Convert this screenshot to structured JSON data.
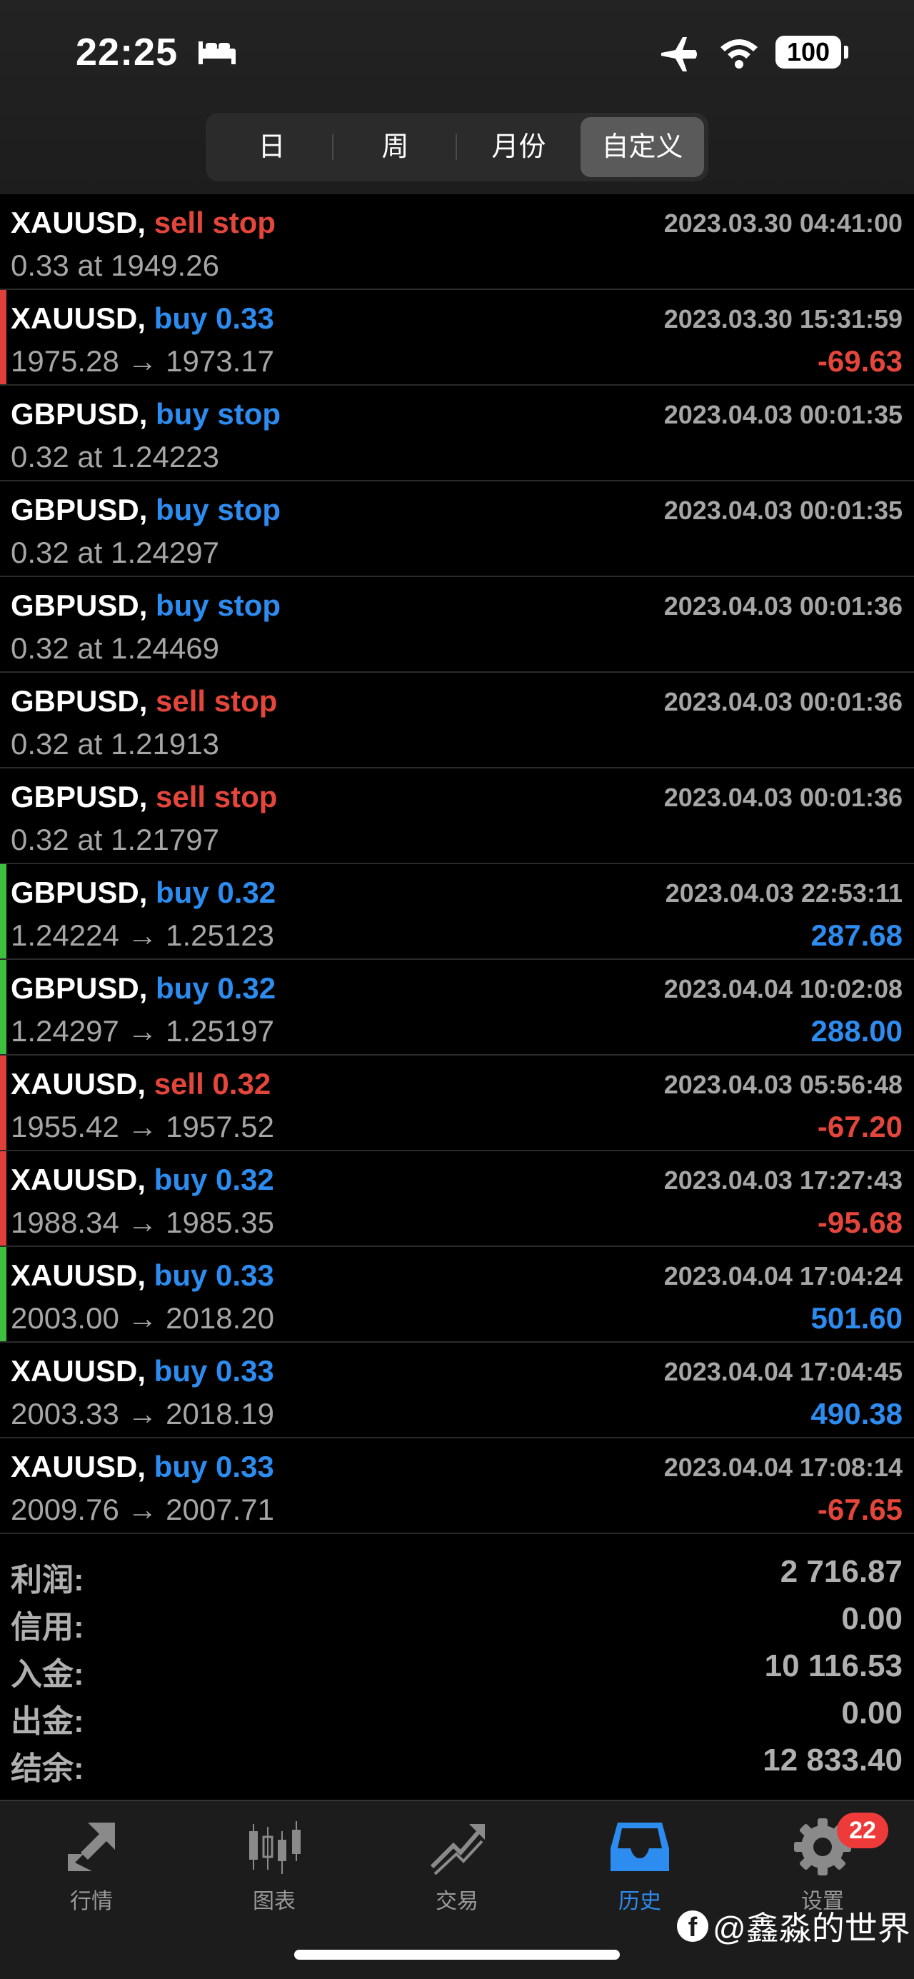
{
  "status_bar": {
    "time": "22:25",
    "battery": "100"
  },
  "segments": [
    {
      "label": "日",
      "active": false
    },
    {
      "label": "周",
      "active": false
    },
    {
      "label": "月份",
      "active": false
    },
    {
      "label": "自定义",
      "active": true
    }
  ],
  "rows": [
    {
      "symbol": "XAUUSD,",
      "type": "sell stop",
      "color": "red",
      "date": "2023.03.30 04:41:00",
      "detail": "0.33 at 1949.26",
      "profit": "",
      "profit_color": "",
      "bar": ""
    },
    {
      "symbol": "XAUUSD,",
      "type": "buy 0.33",
      "color": "blue",
      "date": "2023.03.30 15:31:59",
      "detail": "1975.28 → 1973.17",
      "profit": "-69.63",
      "profit_color": "red",
      "bar": "red"
    },
    {
      "symbol": "GBPUSD,",
      "type": "buy stop",
      "color": "blue",
      "date": "2023.04.03 00:01:35",
      "detail": "0.32 at 1.24223",
      "profit": "",
      "profit_color": "",
      "bar": ""
    },
    {
      "symbol": "GBPUSD,",
      "type": "buy stop",
      "color": "blue",
      "date": "2023.04.03 00:01:35",
      "detail": "0.32 at 1.24297",
      "profit": "",
      "profit_color": "",
      "bar": ""
    },
    {
      "symbol": "GBPUSD,",
      "type": "buy stop",
      "color": "blue",
      "date": "2023.04.03 00:01:36",
      "detail": "0.32 at 1.24469",
      "profit": "",
      "profit_color": "",
      "bar": ""
    },
    {
      "symbol": "GBPUSD,",
      "type": "sell stop",
      "color": "red",
      "date": "2023.04.03 00:01:36",
      "detail": "0.32 at 1.21913",
      "profit": "",
      "profit_color": "",
      "bar": ""
    },
    {
      "symbol": "GBPUSD,",
      "type": "sell stop",
      "color": "red",
      "date": "2023.04.03 00:01:36",
      "detail": "0.32 at 1.21797",
      "profit": "",
      "profit_color": "",
      "bar": ""
    },
    {
      "symbol": "GBPUSD,",
      "type": "buy 0.32",
      "color": "blue",
      "date": "2023.04.03 22:53:11",
      "detail": "1.24224 → 1.25123",
      "profit": "287.68",
      "profit_color": "blue",
      "bar": "green"
    },
    {
      "symbol": "GBPUSD,",
      "type": "buy 0.32",
      "color": "blue",
      "date": "2023.04.04 10:02:08",
      "detail": "1.24297 → 1.25197",
      "profit": "288.00",
      "profit_color": "blue",
      "bar": "green"
    },
    {
      "symbol": "XAUUSD,",
      "type": "sell 0.32",
      "color": "red",
      "date": "2023.04.03 05:56:48",
      "detail": "1955.42 → 1957.52",
      "profit": "-67.20",
      "profit_color": "red",
      "bar": "red"
    },
    {
      "symbol": "XAUUSD,",
      "type": "buy 0.32",
      "color": "blue",
      "date": "2023.04.03 17:27:43",
      "detail": "1988.34 → 1985.35",
      "profit": "-95.68",
      "profit_color": "red",
      "bar": "red"
    },
    {
      "symbol": "XAUUSD,",
      "type": "buy 0.33",
      "color": "blue",
      "date": "2023.04.04 17:04:24",
      "detail": "2003.00 → 2018.20",
      "profit": "501.60",
      "profit_color": "blue",
      "bar": "green"
    },
    {
      "symbol": "XAUUSD,",
      "type": "buy 0.33",
      "color": "blue",
      "date": "2023.04.04 17:04:45",
      "detail": "2003.33 → 2018.19",
      "profit": "490.38",
      "profit_color": "blue",
      "bar": ""
    },
    {
      "symbol": "XAUUSD,",
      "type": "buy 0.33",
      "color": "blue",
      "date": "2023.04.04 17:08:14",
      "detail": "2009.76 → 2007.71",
      "profit": "-67.65",
      "profit_color": "red",
      "bar": ""
    }
  ],
  "summary": [
    {
      "label": "利润:",
      "value": "2 716.87"
    },
    {
      "label": "信用:",
      "value": "0.00"
    },
    {
      "label": "入金:",
      "value": "10 116.53"
    },
    {
      "label": "出金:",
      "value": "0.00"
    },
    {
      "label": "结余:",
      "value": "12 833.40"
    }
  ],
  "tabs": [
    {
      "label": "行情",
      "icon": "quotes-icon",
      "active": false
    },
    {
      "label": "图表",
      "icon": "chart-icon",
      "active": false
    },
    {
      "label": "交易",
      "icon": "trade-icon",
      "active": false
    },
    {
      "label": "历史",
      "icon": "history-icon",
      "active": true
    },
    {
      "label": "设置",
      "icon": "gear-icon",
      "active": false
    }
  ],
  "settings_badge": "22",
  "watermark": "@鑫淼的世界",
  "colors": {
    "blue": "#2d8cf0",
    "red": "#e4463c",
    "green_bar": "#3fbf3f",
    "red_bar": "#e0403a"
  }
}
